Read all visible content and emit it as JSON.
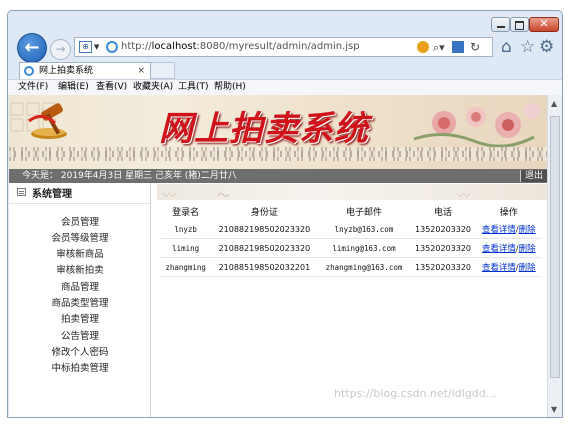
{
  "browser": {
    "address_url_prefix": "http://",
    "address_url_host": "localhost",
    "address_url_rest": ":8080/myresult/admin/admin.jsp",
    "tab_title": "网上拍卖系统",
    "tab_close": "×"
  },
  "menu": {
    "items": [
      "文件(F)",
      "编辑(E)",
      "查看(V)",
      "收藏夹(A)",
      "工具(T)",
      "帮助(H)"
    ]
  },
  "page": {
    "banner_title": "网上拍卖系统",
    "date_text": "今天是：  2019年4月3日  星期三  己亥年 (猪)二月廿八",
    "logout": "退出",
    "sidebar_heading": "系统管理",
    "sidebar_items": [
      "会员管理",
      "会员等级管理",
      "审核新商品",
      "审核新拍卖",
      "商品管理",
      "商品类型管理",
      "拍卖管理",
      "公告管理",
      "修改个人密码",
      "中标拍卖管理"
    ],
    "table": {
      "columns": [
        "登录名",
        "身份证",
        "电子邮件",
        "电话",
        "操作"
      ],
      "rows": [
        {
          "login": "lnyzb",
          "id_card": "210882198502023320",
          "email": "lnyzb@163.com",
          "phone": "13520203320"
        },
        {
          "login": "liming",
          "id_card": "210882198502023320",
          "email": "liming@163.com",
          "phone": "13520203320"
        },
        {
          "login": "zhangming",
          "id_card": "210885198502032201",
          "email": "zhangming@163.com",
          "phone": "13520203320"
        }
      ],
      "action_view": "查看详情",
      "action_sep": "/",
      "action_delete": "删除"
    }
  },
  "watermark": "https://blog.csdn.net/idlgdd..."
}
